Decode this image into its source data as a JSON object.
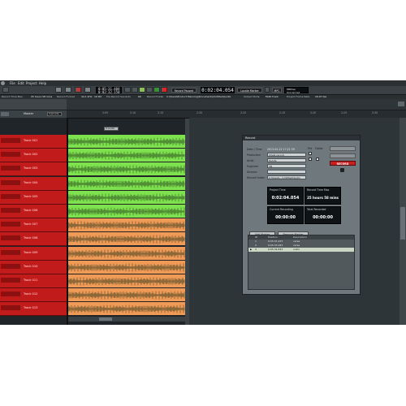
{
  "menu": [
    "File",
    "Edit",
    "Project",
    "Help"
  ],
  "transport": {
    "left_lcd_lines": [
      "0:05:31.484",
      "0:02:32.150"
    ],
    "button_icons": [
      "rewind-icon",
      "forward-icon",
      "loop-icon",
      "stop-icon",
      "play-icon",
      "record-icon"
    ],
    "record_paused_label": "Record Paused",
    "main_time": "0:02:04.054",
    "locate_marker_label": "Locate Marker",
    "mpc_label": "MPC",
    "right_lcd_lines": [
      "00Rtae",
      "Unlimited"
    ]
  },
  "status": [
    "Record Time Max",
    "25 hours 58 mins",
    "Record Format",
    "44.1 kHz · 16 Bit",
    "Pre-Record Seconds",
    "60",
    "Record Folder",
    "C:\\Users\\Product Planning\\Documents\\Untitled\\Audio",
    "Output Mode",
    "Multi track",
    "Project Frame Rate",
    "29.97 fps"
  ],
  "master_label": "Master",
  "master_mode": "Cascade",
  "ruler_labels": [
    "2:05",
    "2:10",
    "2:15",
    "2:20",
    "2:25",
    "2:15",
    "2:20",
    "2:25",
    "2:30"
  ],
  "clip_tag": "0-audio",
  "tracks": [
    {
      "name": "Track 001",
      "color": "#7ee24f"
    },
    {
      "name": "Track 002",
      "color": "#7ee24f"
    },
    {
      "name": "Track 003",
      "color": "#7ee24f"
    },
    {
      "name": "Track 004",
      "color": "#7ee24f"
    },
    {
      "name": "Track 005",
      "color": "#7ee24f"
    },
    {
      "name": "Track 006",
      "color": "#7ee24f"
    },
    {
      "name": "Track 007",
      "color": "#ef9a56"
    },
    {
      "name": "Track 008",
      "color": "#ef9a56"
    },
    {
      "name": "Track 009",
      "color": "#ef9a56"
    },
    {
      "name": "Track 010",
      "color": "#ef9a56"
    },
    {
      "name": "Track 011",
      "color": "#ef9a56"
    },
    {
      "name": "Track 012",
      "color": "#ef9a56"
    },
    {
      "name": "Track 013",
      "color": "#ef9a56"
    }
  ],
  "record_panel": {
    "title": "Record",
    "date_time_label": "Date / Time",
    "date_time_value": "2013-04-22 17:21:39",
    "production_label": "Production",
    "production_value": "Chelk record",
    "artist_label": "Artist",
    "artist_value": "M.Arts",
    "engineer_label": "Engineer",
    "engineer_value": "TB",
    "director_label": "Director",
    "director_value": "",
    "record_folder_label": "Record Folder",
    "record_folder_value": "C:\\Users\\...\\Untitled\\Audio",
    "file_label": "File",
    "folder_label": "Folder",
    "record_button": "RECORD",
    "boxes": [
      {
        "label": "Project Time",
        "value": "0:02:04.054"
      },
      {
        "label": "Record Time Max",
        "value": "25 hours 58 mins"
      },
      {
        "label": "Current Recording",
        "value": "00:00:00"
      },
      {
        "label": "Total Recorded",
        "value": "00:00:00"
      }
    ],
    "add_marker": "Add Marker",
    "remove_marker": "Remove Marker",
    "marker_columns": [
      "ID",
      "Position",
      "Description"
    ],
    "markers": [
      {
        "id": "1",
        "position": "0:05:31.247",
        "description": "verse"
      },
      {
        "id": "2",
        "position": "0:05:33.183",
        "description": "verse"
      },
      {
        "id": "3",
        "position": "0:05:34.833",
        "description": "outro"
      }
    ]
  }
}
